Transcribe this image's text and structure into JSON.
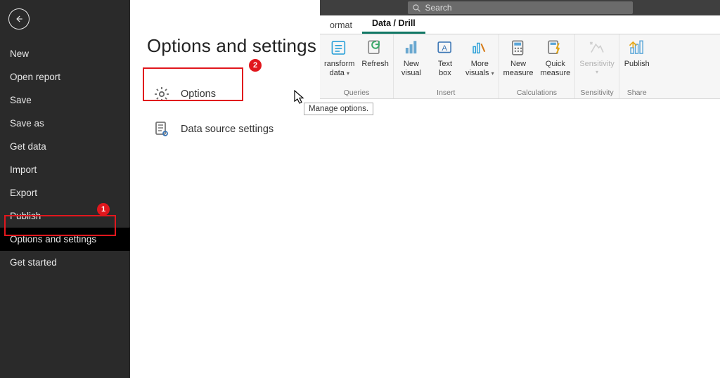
{
  "accent_colors": {
    "annotation_red": "#e1171d",
    "tab_underline": "#117865"
  },
  "search": {
    "placeholder": "Search"
  },
  "ribbon_tabs": {
    "format": "ormat",
    "data_drill": "Data / Drill"
  },
  "ribbon": {
    "queries": {
      "label": "Queries",
      "transform_line1": "ransform",
      "transform_line2": "data",
      "refresh": "Refresh"
    },
    "insert": {
      "label": "Insert",
      "new_visual_line1": "New",
      "new_visual_line2": "visual",
      "text_box_line1": "Text",
      "text_box_line2": "box",
      "more_visuals_line1": "More",
      "more_visuals_line2": "visuals"
    },
    "calculations": {
      "label": "Calculations",
      "new_measure_line1": "New",
      "new_measure_line2": "measure",
      "quick_measure_line1": "Quick",
      "quick_measure_line2": "measure"
    },
    "sensitivity": {
      "label": "Sensitivity",
      "button": "Sensitivity"
    },
    "share": {
      "label": "Share",
      "publish": "Publish"
    }
  },
  "sidebar": {
    "items": [
      "New",
      "Open report",
      "Save",
      "Save as",
      "Get data",
      "Import",
      "Export",
      "Publish",
      "Options and settings",
      "Get started"
    ]
  },
  "panel": {
    "title": "Options and settings",
    "options": "Options",
    "data_source_settings": "Data source settings"
  },
  "annotations": {
    "badge1": "1",
    "badge2": "2"
  },
  "tooltip": "Manage options."
}
